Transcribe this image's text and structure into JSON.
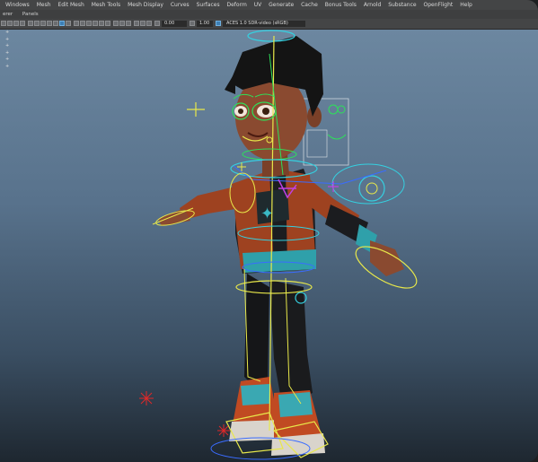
{
  "menu": [
    "Windows",
    "Mesh",
    "Edit Mesh",
    "Mesh Tools",
    "Mesh Display",
    "Curves",
    "Surfaces",
    "Deform",
    "UV",
    "Generate",
    "Cache",
    "Bonus Tools",
    "Arnold",
    "Substance",
    "OpenFlight",
    "Help"
  ],
  "panels_menu": [
    "erer",
    "Panels"
  ],
  "toolbar": {
    "field_a": "0.00",
    "field_b": "1.00",
    "colorspace": "ACES 1.0 SDR-video (sRGB)"
  },
  "outliner_marks": [
    "+",
    "+",
    "+",
    "+",
    "+",
    "+"
  ],
  "colors": {
    "rig_yellow": "#e8e84a",
    "rig_green": "#2ee05a",
    "rig_cyan": "#35d0e0",
    "rig_blue": "#3a6cff",
    "rig_magenta": "#c040e0",
    "rig_red": "#e02828",
    "jacket": "#a64a22",
    "skin": "#8a4a30"
  }
}
